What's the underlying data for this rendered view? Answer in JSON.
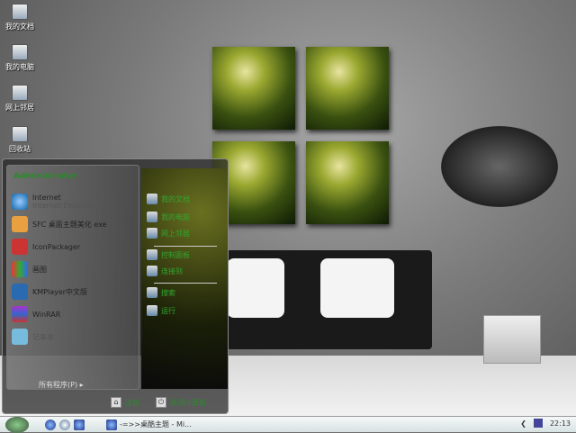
{
  "desktop": {
    "icons": [
      {
        "label": "我的文档"
      },
      {
        "label": "我的电脑"
      },
      {
        "label": "网上邻居"
      },
      {
        "label": "回收站"
      }
    ]
  },
  "start_menu": {
    "user": "Administrator",
    "left_items": [
      {
        "label": "Internet",
        "sub": "Internet Explorer"
      },
      {
        "label": "SFC 桌面主题美化 exe"
      },
      {
        "label": "IconPackager"
      },
      {
        "label": "画图"
      },
      {
        "label": "KMPlayer中文版"
      },
      {
        "label": "WinRAR"
      },
      {
        "label": "记事本"
      }
    ],
    "all_programs": "所有程序(P)",
    "right_items": [
      {
        "label": "我的文档"
      },
      {
        "label": "我的电脑"
      },
      {
        "label": "网上邻居"
      },
      {
        "label": "控制面板"
      },
      {
        "label": "连接到"
      },
      {
        "label": "搜索"
      },
      {
        "label": "运行"
      }
    ],
    "logoff": "注销",
    "shutdown": "关闭计算机"
  },
  "taskbar": {
    "task": "-=>>桌酷主题 - Mi...",
    "clock": "22:13"
  }
}
